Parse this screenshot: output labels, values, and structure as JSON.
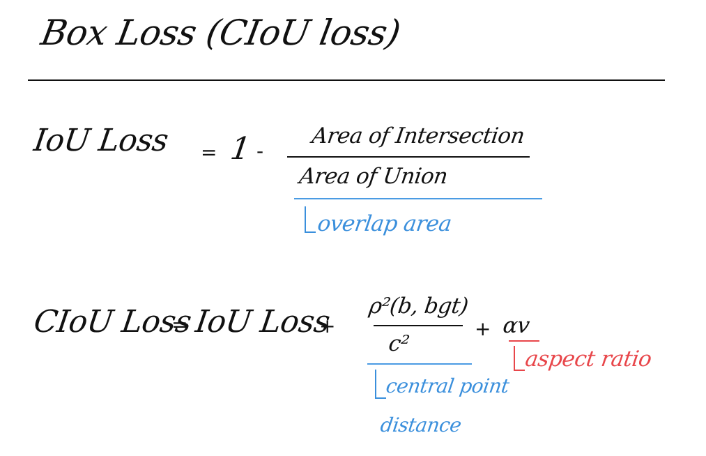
{
  "title": "Box Loss (CIoU loss)",
  "iou": {
    "lhs": "IoU Loss",
    "equals": "=",
    "one": "1",
    "minus": "-",
    "numerator": "Area of Intersection",
    "denominator": "Area of Union",
    "annotation": "overlap area"
  },
  "ciou": {
    "lhs": "CIoU Loss",
    "equals": "=",
    "term1": "IoU Loss",
    "plus1": "+",
    "numerator": "ρ²(b, bgt)",
    "denominator": "c²",
    "plus2": "+",
    "alpha_v": "αv",
    "annotation_blue_line1": "central point",
    "annotation_blue_line2": "distance",
    "annotation_red": "aspect ratio"
  },
  "colors": {
    "ink": "#111111",
    "blue": "#3a8fdc",
    "red": "#e8464a",
    "background": "#ffffff"
  }
}
